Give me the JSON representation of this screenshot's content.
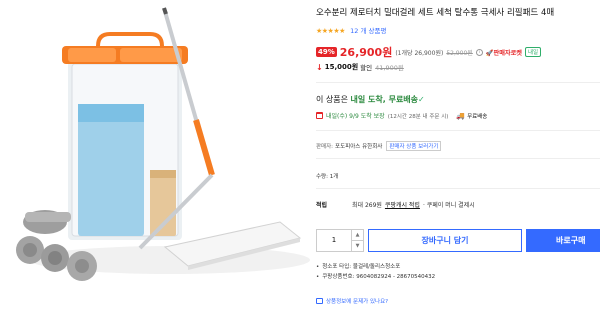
{
  "product": {
    "title": "오수분리 제로터치 밀대걸레 세트 세척 탈수통 극세사 리필패드 4매",
    "stars": "★★★★★",
    "rating_count": "12 개 상품평"
  },
  "price": {
    "discount": "49%",
    "sale": "26,900원",
    "unit": "(1개당 26,900원)",
    "original": "52,900원",
    "info_icon": "i",
    "rocket": "🚀판매자로켓",
    "tomorrow_badge": "내일"
  },
  "coupon": {
    "arrow": "↓",
    "amount": "15,000원",
    "label": "할인",
    "original": "41,900원"
  },
  "delivery": {
    "lead": "이 상품은 ",
    "highlight": "내일 도착, 무료배송",
    "check": "✓",
    "arrival_date": "내일(수) 9/9 도착 보장",
    "arrival_note": "(12시간 28분 내 주문 시)",
    "truck_icon": "🚚",
    "return_label": "무료배송"
  },
  "seller": {
    "label": "판매자:",
    "name": "포도피아스 유한회사",
    "button": "판매자 상품 보러가기"
  },
  "quantity": {
    "label": "수량: 1개",
    "value": "1",
    "up": "▲",
    "down": "▼"
  },
  "points": {
    "label": "적립",
    "text": "최대 269원",
    "link": "쿠팡캐시 적립",
    "pay": "· 쿠페이 머니 결제시"
  },
  "buttons": {
    "cart": "장바구니 담기",
    "buy": "바로구매"
  },
  "meta": [
    "청소포 타입: 물걸레/돌리스청소포",
    "쿠팡상품번호: 9604082924 - 28670540432"
  ],
  "inquiry": "상품정보에 문제가 있나요?",
  "colors": {
    "accent_red": "#e52528",
    "accent_blue": "#346aff",
    "delivery_green": "#2c8a3f",
    "bucket_orange": "#f57c22"
  }
}
